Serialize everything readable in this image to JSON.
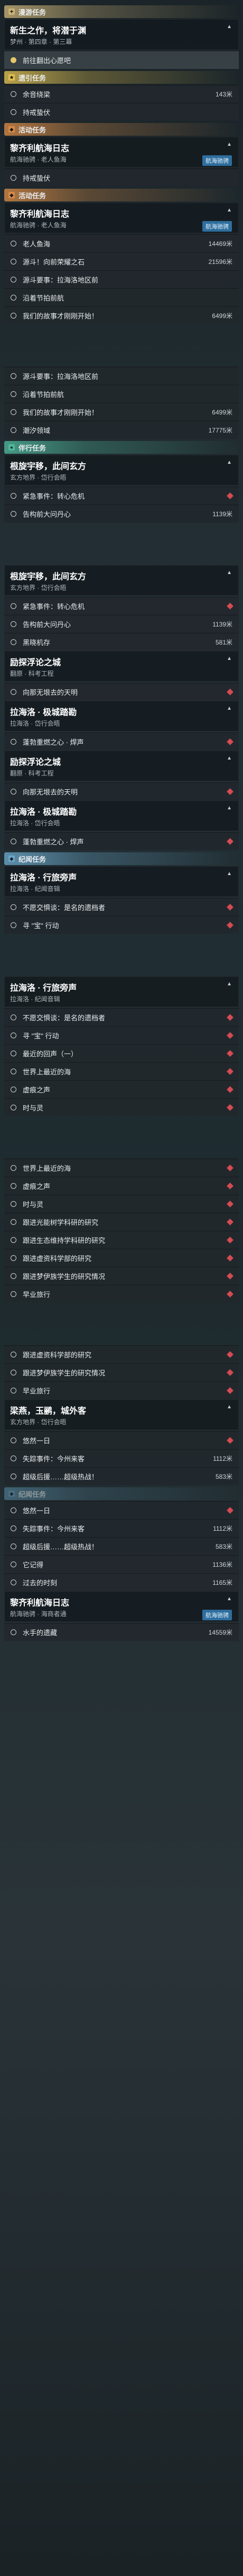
{
  "sections": [
    {
      "kind": "section",
      "label": "漫游任务",
      "color": "#c9b178",
      "icon": "✦"
    },
    {
      "kind": "card",
      "title": "新生之作，将潜于渊",
      "sub": "梦州 · 第四章 · 第三幕"
    },
    {
      "kind": "row",
      "label": "前往翻出心愿吧",
      "active": true,
      "selected": true
    },
    {
      "kind": "section",
      "label": "遗引任务",
      "color": "#e0c052",
      "icon": "★"
    },
    {
      "kind": "row",
      "label": "余音绕梁",
      "dist": "143米"
    },
    {
      "kind": "row",
      "label": "持戒蛰伏"
    },
    {
      "kind": "section",
      "label": "活动任务",
      "color": "#d58a47",
      "icon": "◆"
    },
    {
      "kind": "card",
      "title": "黎齐利航海日志",
      "sub": "航海驰骋 · 老人鱼海",
      "badge": "航海驰骋"
    },
    {
      "kind": "row",
      "label": "持戒蛰伏"
    },
    {
      "kind": "section",
      "label": "活动任务",
      "color": "#d58a47",
      "icon": "◆"
    },
    {
      "kind": "card",
      "title": "黎齐利航海日志",
      "sub": "航海驰骋 · 老人鱼海",
      "badge": "航海驰骋"
    },
    {
      "kind": "row",
      "label": "老人鱼海",
      "dist": "14469米"
    },
    {
      "kind": "row",
      "label": "源斗！向前荣耀之石",
      "dist": "21596米"
    },
    {
      "kind": "row",
      "label": "源斗要事：拉海洛地区前",
      "dist": ""
    },
    {
      "kind": "row",
      "label": "沿着节拍前航",
      "dist": ""
    },
    {
      "kind": "row",
      "label": "我们的故事才刚刚开始！",
      "dist": "6499米"
    },
    {
      "kind": "trans"
    },
    {
      "kind": "row",
      "label": "源斗要事：拉海洛地区前",
      "dist": ""
    },
    {
      "kind": "row",
      "label": "沿着节拍前航",
      "dist": ""
    },
    {
      "kind": "row",
      "label": "我们的故事才刚刚开始！",
      "dist": "6499米"
    },
    {
      "kind": "row",
      "label": "潮汐领域",
      "dist": "17775米"
    },
    {
      "kind": "section",
      "label": "伴行任务",
      "color": "#4fb59a",
      "icon": "●"
    },
    {
      "kind": "card",
      "title": "根旋宇移，此间玄方",
      "sub": "玄方地界 · 岱行会晤"
    },
    {
      "kind": "row",
      "label": "紧急事件：转心危机",
      "diamond": true
    },
    {
      "kind": "row",
      "label": "告构前大问丹心",
      "dist": "1139米"
    },
    {
      "kind": "trans"
    },
    {
      "kind": "card",
      "title": "根旋宇移，此间玄方",
      "sub": "玄方地界 · 岱行会晤"
    },
    {
      "kind": "row",
      "label": "紧急事件：转心危机",
      "diamond": true
    },
    {
      "kind": "row",
      "label": "告构前大问丹心",
      "dist": "1139米"
    },
    {
      "kind": "row",
      "label": "黑晓机存",
      "dist": "581米"
    },
    {
      "kind": "card",
      "title": "励探浮论之城",
      "sub": "翻原 · 科考工程"
    },
    {
      "kind": "row",
      "label": "向那无垠去的天明",
      "diamond": true
    },
    {
      "kind": "card",
      "title": "拉海洛 · 极城踏勘",
      "sub": "拉海洛 · 岱行会晤"
    },
    {
      "kind": "row",
      "label": "蓬勃重燃之心 · 焊声",
      "diamond": true
    },
    {
      "kind": "card",
      "title": "励探浮论之城",
      "sub": "翻原 · 科考工程"
    },
    {
      "kind": "row",
      "label": "向那无垠去的天明",
      "diamond": true
    },
    {
      "kind": "card",
      "title": "拉海洛 · 极城踏勘",
      "sub": "拉海洛 · 岱行会晤"
    },
    {
      "kind": "row",
      "label": "蓬勃重燃之心 · 焊声",
      "diamond": true
    },
    {
      "kind": "section",
      "label": "纪闻任务",
      "color": "#6aa6c8",
      "icon": "◈"
    },
    {
      "kind": "card",
      "title": "拉海洛 · 行旅旁声",
      "sub": "拉海洛 · 纪闻音辑"
    },
    {
      "kind": "row",
      "label": "不愿交惧谈：是名的遗档者",
      "diamond": true
    },
    {
      "kind": "row",
      "label": "寻 \"宝\" 行动",
      "diamond": true
    },
    {
      "kind": "trans"
    },
    {
      "kind": "card",
      "title": "拉海洛 · 行旅旁声",
      "sub": "拉海洛 · 纪闻音辑"
    },
    {
      "kind": "row",
      "label": "不愿交惧谈：是名的遗档者",
      "diamond": true
    },
    {
      "kind": "row",
      "label": "寻 \"宝\" 行动",
      "diamond": true
    },
    {
      "kind": "row",
      "label": "最近的回声（一）",
      "diamond": true
    },
    {
      "kind": "row",
      "label": "世界上最近的海",
      "diamond": true
    },
    {
      "kind": "row",
      "label": "虚痕之声",
      "diamond": true
    },
    {
      "kind": "row",
      "label": "时与灵",
      "diamond": true
    },
    {
      "kind": "trans"
    },
    {
      "kind": "row",
      "label": "世界上最近的海",
      "diamond": true
    },
    {
      "kind": "row",
      "label": "虚痕之声",
      "diamond": true
    },
    {
      "kind": "row",
      "label": "时与灵",
      "diamond": true
    },
    {
      "kind": "row",
      "label": "跟进光能树学科研的研究",
      "diamond": true
    },
    {
      "kind": "row",
      "label": "跟进生态维持学科研的研究",
      "diamond": true
    },
    {
      "kind": "row",
      "label": "跟进虚资科学部的研究",
      "diamond": true
    },
    {
      "kind": "row",
      "label": "跟进梦伊族学生的研究情况",
      "diamond": true
    },
    {
      "kind": "row",
      "label": "早业旅行",
      "diamond": true
    },
    {
      "kind": "trans"
    },
    {
      "kind": "row",
      "label": "跟进虚资科学部的研究",
      "diamond": true
    },
    {
      "kind": "row",
      "label": "跟进梦伊族学生的研究情况",
      "diamond": true
    },
    {
      "kind": "row",
      "label": "早业旅行",
      "diamond": true
    },
    {
      "kind": "card",
      "title": "梁燕，玉鹂，城外客",
      "sub": "玄方地界 · 岱行会晤"
    },
    {
      "kind": "row",
      "label": "悠然一日",
      "diamond": true
    },
    {
      "kind": "row",
      "label": "失踪事件：今州来客",
      "dist": "1112米"
    },
    {
      "kind": "row",
      "label": "超级后援……超级热战！",
      "dist": "583米"
    },
    {
      "kind": "section",
      "label": "纪闻任务",
      "color": "#6aa6c8",
      "icon": "◈",
      "dim": true
    },
    {
      "kind": "row",
      "label": "悠然一日",
      "diamond": true
    },
    {
      "kind": "row",
      "label": "失踪事件：今州来客",
      "dist": "1112米"
    },
    {
      "kind": "row",
      "label": "超级后援……超级热战！",
      "dist": "583米"
    },
    {
      "kind": "row",
      "label": "它记得",
      "dist": "1136米"
    },
    {
      "kind": "row",
      "label": "过去的时刻",
      "dist": "1165米"
    },
    {
      "kind": "card",
      "title": "黎齐利航海日志",
      "sub": "航海驰骋 · 海商者通",
      "badge": "航海驰骋"
    },
    {
      "kind": "row",
      "label": "水手的遗藏",
      "dist": "14559米"
    }
  ]
}
